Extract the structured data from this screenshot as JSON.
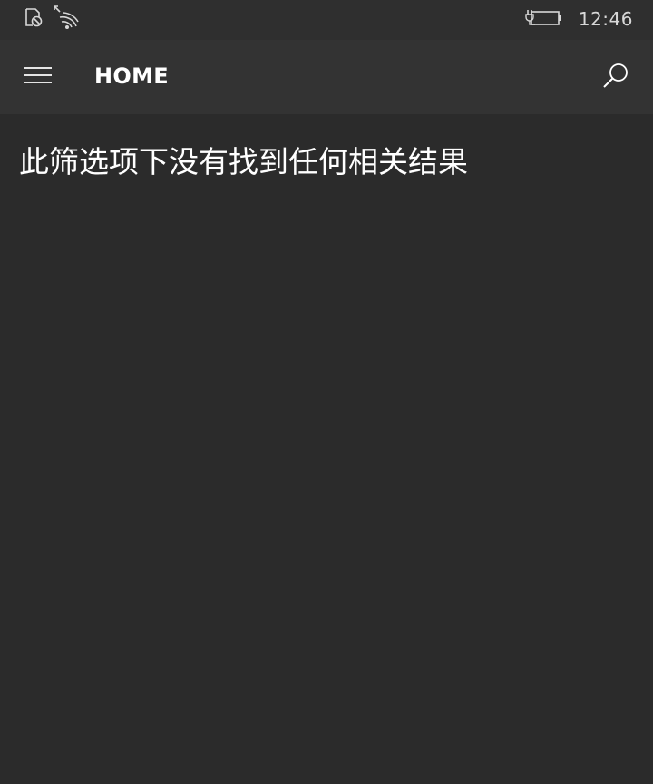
{
  "status_bar": {
    "left_icons": [
      "do-not-disturb-icon",
      "wifi-signal-icon"
    ],
    "right_icons": [
      "battery-charging-icon"
    ],
    "time": "12:46"
  },
  "app_bar": {
    "menu_icon": "hamburger-menu-icon",
    "title": "HOME",
    "search_icon": "search-icon"
  },
  "content": {
    "empty_message": "此筛选项下没有找到任何相关结果"
  },
  "colors": {
    "background": "#2b2b2b",
    "app_bar": "#333333",
    "status_bar": "#2f2f2f",
    "text": "#ffffff",
    "icon": "#d8d8d8"
  }
}
